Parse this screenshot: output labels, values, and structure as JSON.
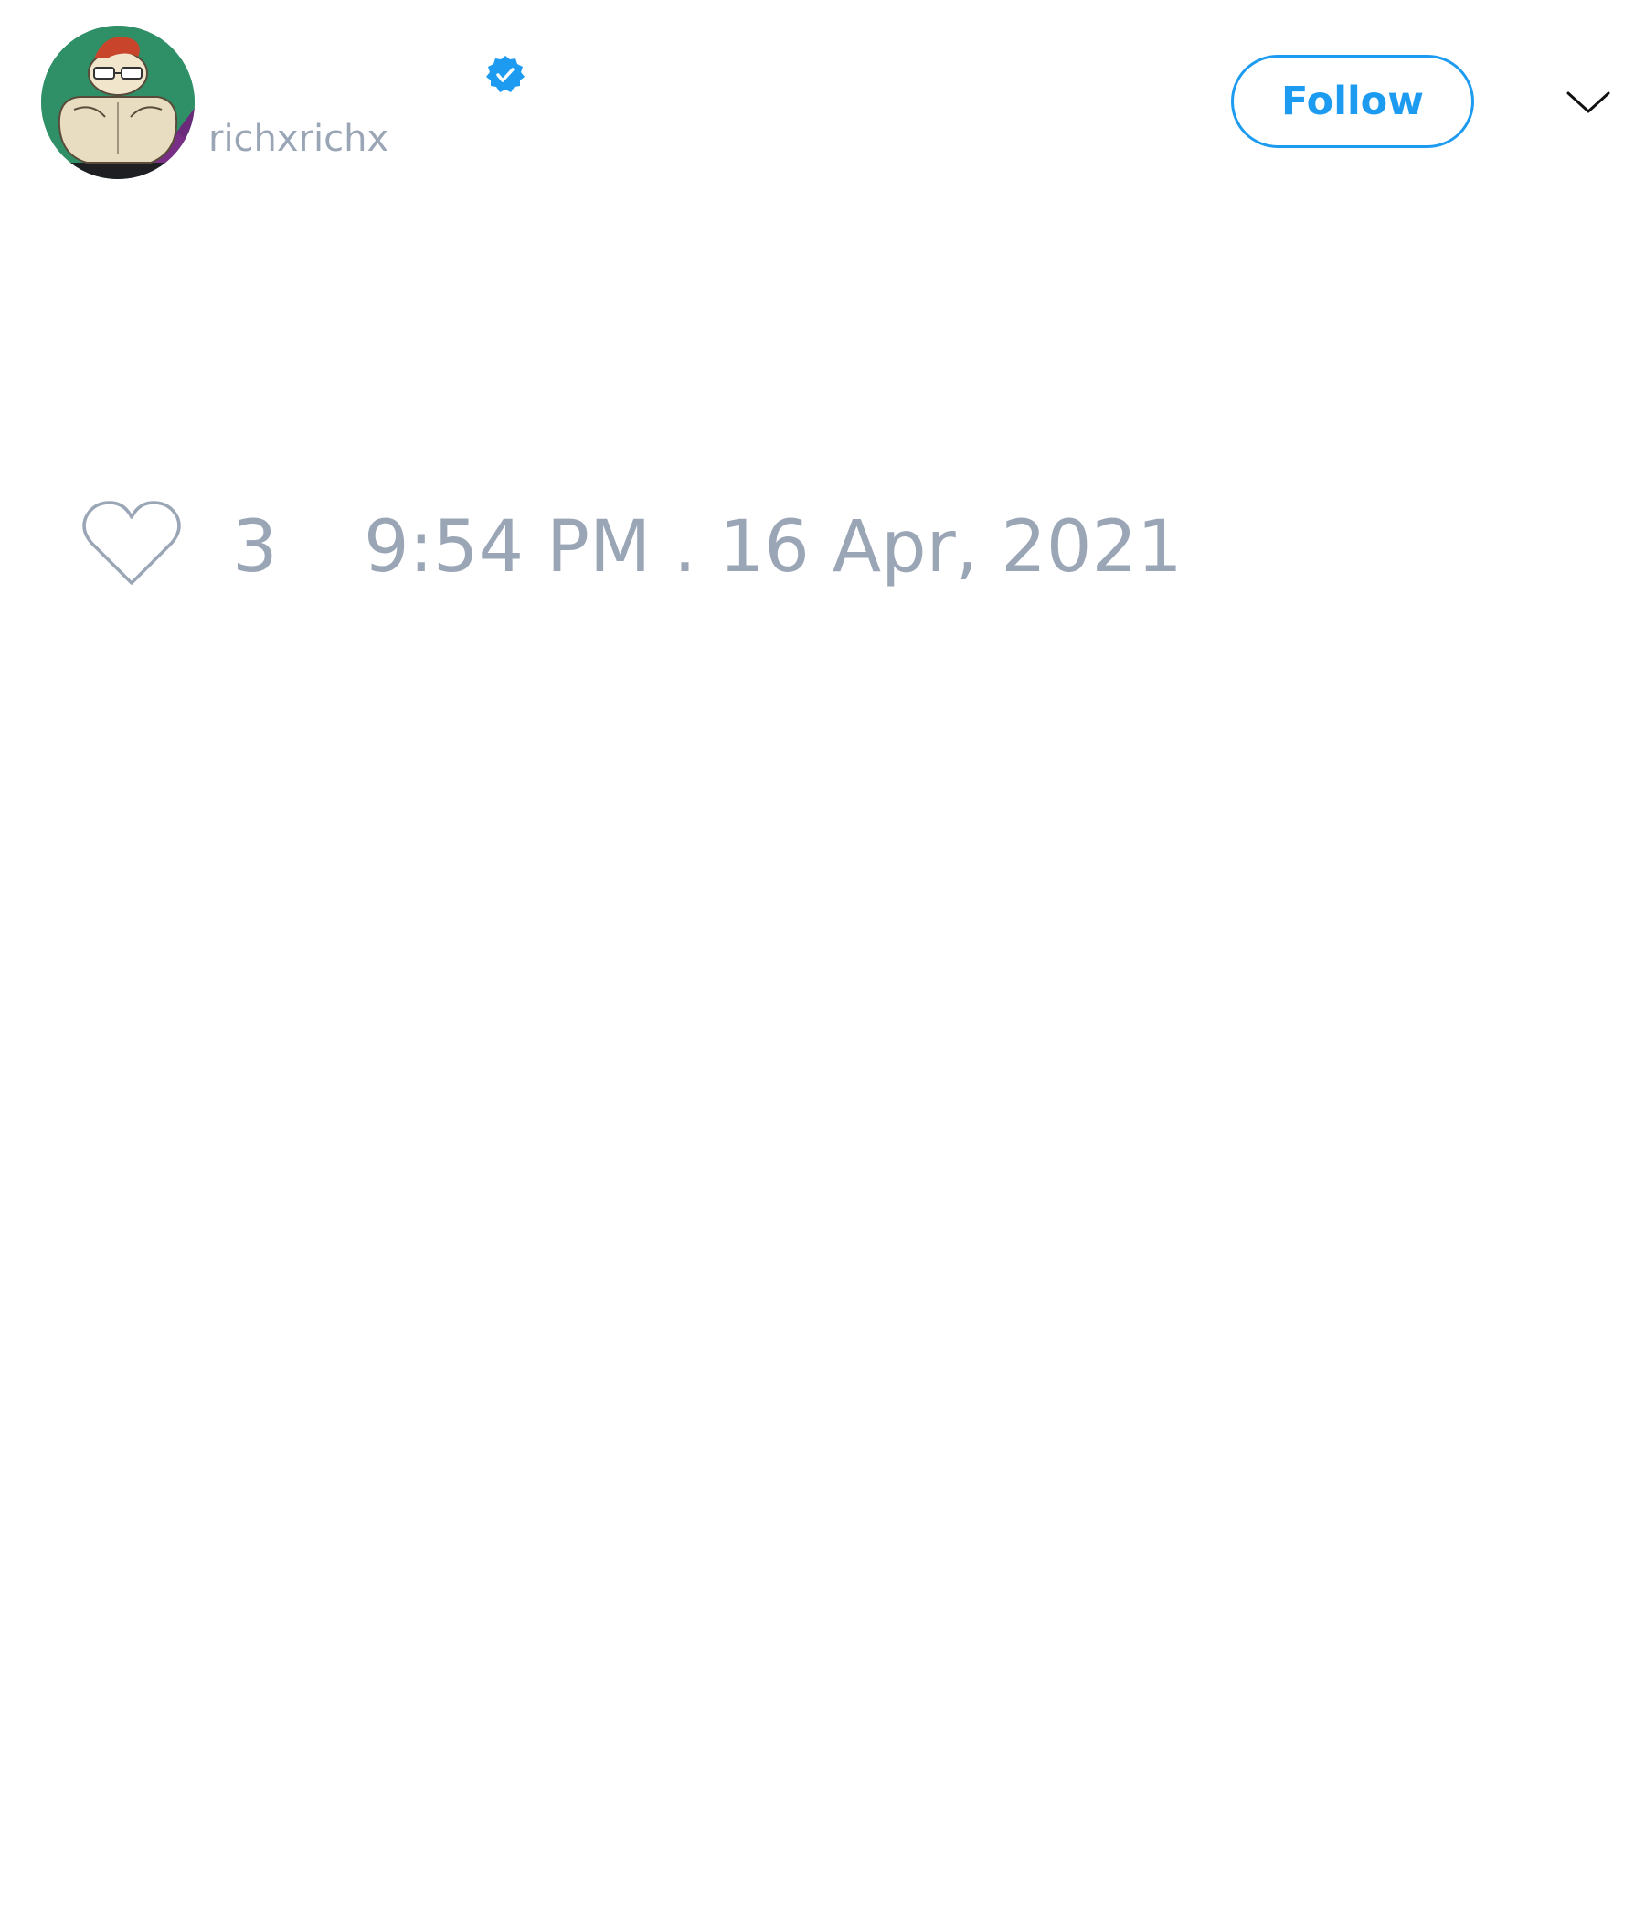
{
  "tweet": {
    "author": {
      "handle": "richxrichx",
      "verified": true,
      "avatar_icon": "cartoon-character-avatar"
    },
    "follow_label": "Follow",
    "more_icon": "chevron-down-icon",
    "likes": {
      "icon": "heart-icon",
      "count": "3"
    },
    "timestamp": "9:54 PM . 16 Apr, 2021"
  },
  "colors": {
    "accent": "#1d9bf0",
    "muted_text": "#9aa6b6",
    "background": "#ffffff"
  }
}
